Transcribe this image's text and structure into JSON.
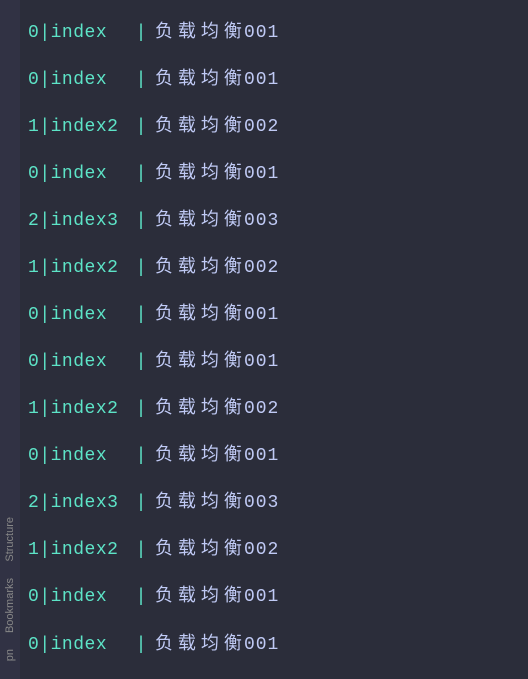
{
  "sidebar": {
    "tabs": [
      {
        "label": "Structure"
      },
      {
        "label": "Bookmarks"
      },
      {
        "label": "pn"
      }
    ]
  },
  "console": {
    "lines": [
      {
        "id": "0",
        "name": "index",
        "message": "负载均衡",
        "num": "001"
      },
      {
        "id": "0",
        "name": "index",
        "message": "负载均衡",
        "num": "001"
      },
      {
        "id": "1",
        "name": "index2",
        "message": "负载均衡",
        "num": "002"
      },
      {
        "id": "0",
        "name": "index",
        "message": "负载均衡",
        "num": "001"
      },
      {
        "id": "2",
        "name": "index3",
        "message": "负载均衡",
        "num": "003"
      },
      {
        "id": "1",
        "name": "index2",
        "message": "负载均衡",
        "num": "002"
      },
      {
        "id": "0",
        "name": "index",
        "message": "负载均衡",
        "num": "001"
      },
      {
        "id": "0",
        "name": "index",
        "message": "负载均衡",
        "num": "001"
      },
      {
        "id": "1",
        "name": "index2",
        "message": "负载均衡",
        "num": "002"
      },
      {
        "id": "0",
        "name": "index",
        "message": "负载均衡",
        "num": "001"
      },
      {
        "id": "2",
        "name": "index3",
        "message": "负载均衡",
        "num": "003"
      },
      {
        "id": "1",
        "name": "index2",
        "message": "负载均衡",
        "num": "002"
      },
      {
        "id": "0",
        "name": "index",
        "message": "负载均衡",
        "num": "001"
      },
      {
        "id": "0",
        "name": "index",
        "message": "负载均衡",
        "num": "001"
      }
    ]
  }
}
